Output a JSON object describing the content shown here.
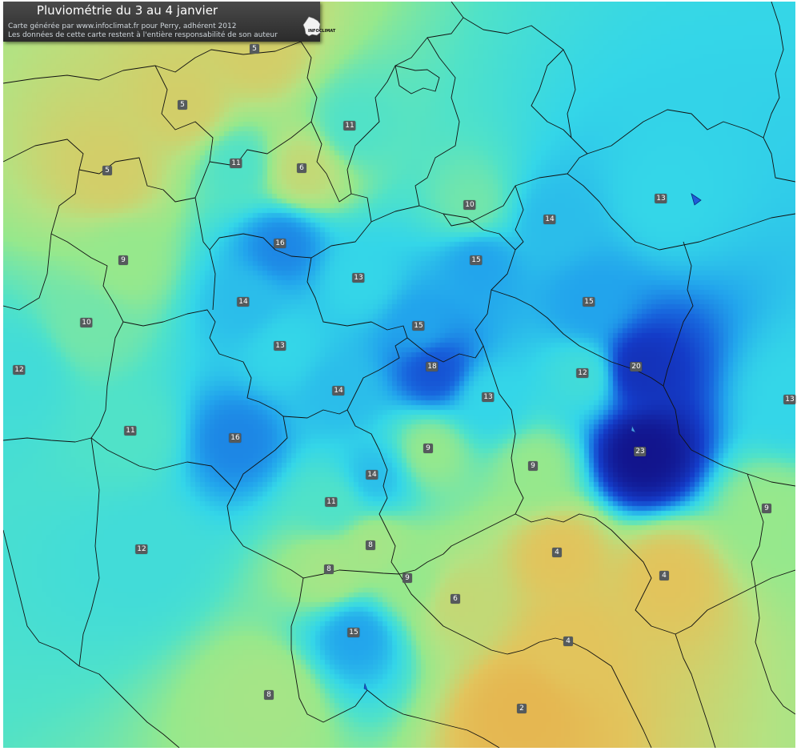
{
  "header": {
    "title": "Pluviométrie du 3 au 4 janvier",
    "credit": "Carte générée par www.infoclimat.fr pour Perry, adhérent 2012",
    "disclaimer": "Les données de cette carte restent à l'entière responsabilité de son auteur",
    "logo_text": "INFOCLIMAT"
  },
  "colors": {
    "base": "#3fd8e6",
    "dry": "#e8b24a",
    "wet": "#1a3fd4",
    "very_wet": "#14148c",
    "border": "#111111"
  },
  "stations": [
    {
      "value": "5"
    },
    {
      "value": "5"
    },
    {
      "value": "5"
    },
    {
      "value": "6"
    },
    {
      "value": "11"
    },
    {
      "value": "11"
    },
    {
      "value": "10"
    },
    {
      "value": "14"
    },
    {
      "value": "13"
    },
    {
      "value": "16"
    },
    {
      "value": "9"
    },
    {
      "value": "15"
    },
    {
      "value": "13"
    },
    {
      "value": "14"
    },
    {
      "value": "15"
    },
    {
      "value": "10"
    },
    {
      "value": "12"
    },
    {
      "value": "13"
    },
    {
      "value": "15"
    },
    {
      "value": "18"
    },
    {
      "value": "20"
    },
    {
      "value": "12"
    },
    {
      "value": "14"
    },
    {
      "value": "13"
    },
    {
      "value": "13"
    },
    {
      "value": "11"
    },
    {
      "value": "16"
    },
    {
      "value": "9"
    },
    {
      "value": "9"
    },
    {
      "value": "23"
    },
    {
      "value": "14"
    },
    {
      "value": "11"
    },
    {
      "value": "9"
    },
    {
      "value": "12"
    },
    {
      "value": "8"
    },
    {
      "value": "4"
    },
    {
      "value": "4"
    },
    {
      "value": "8"
    },
    {
      "value": "9"
    },
    {
      "value": "6"
    },
    {
      "value": "15"
    },
    {
      "value": "4"
    },
    {
      "value": "8"
    },
    {
      "value": "2"
    }
  ]
}
